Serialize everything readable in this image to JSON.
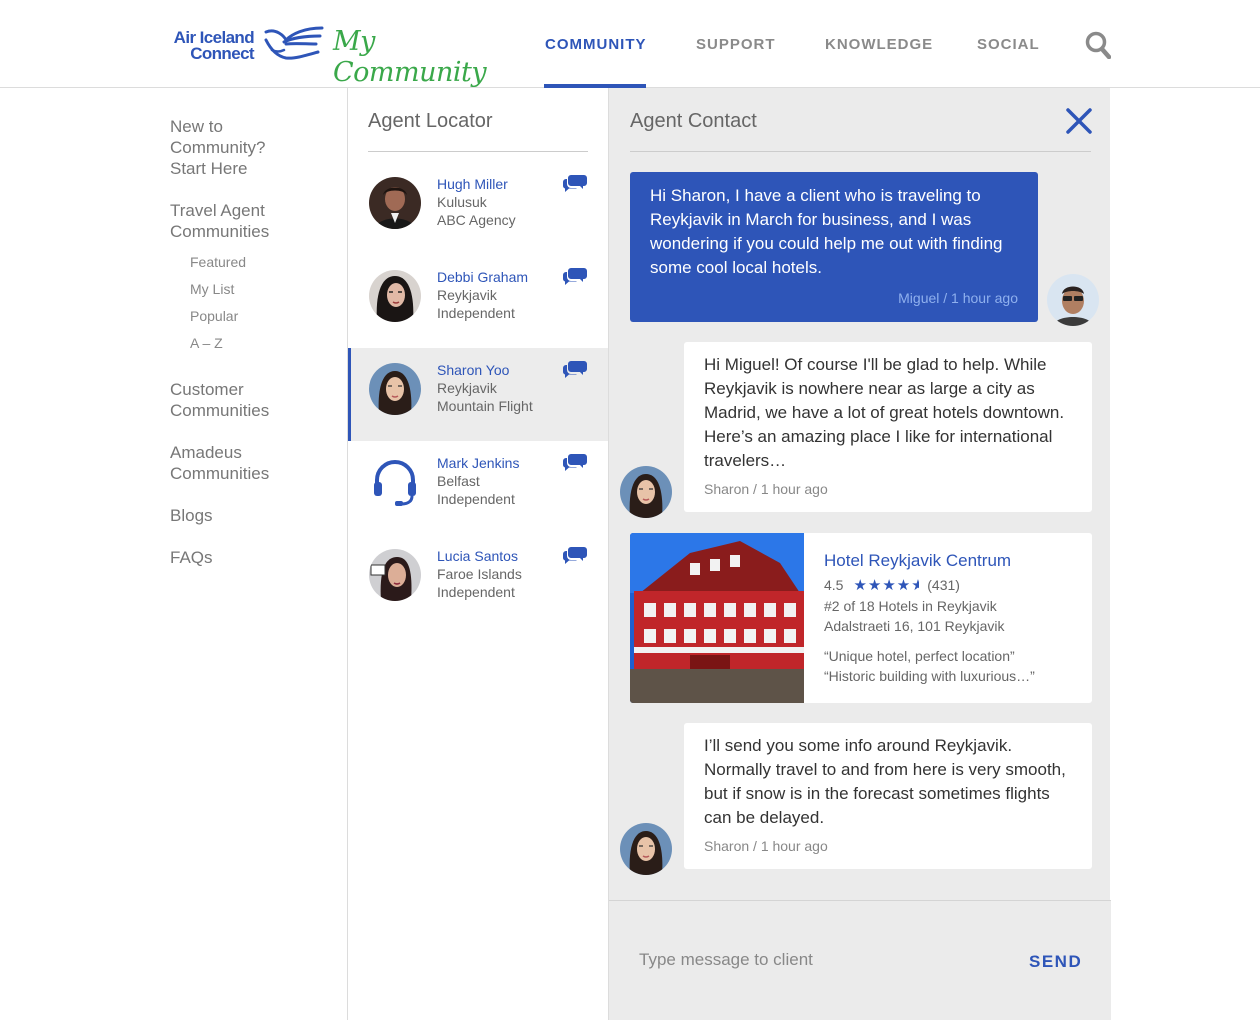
{
  "brand": {
    "name_line1": "Air Iceland",
    "name_line2": "Connect",
    "script_title": "My Community"
  },
  "nav": {
    "items": [
      {
        "label": "COMMUNITY",
        "active": true
      },
      {
        "label": "SUPPORT",
        "active": false
      },
      {
        "label": "KNOWLEDGE",
        "active": false
      },
      {
        "label": "SOCIAL",
        "active": false
      }
    ],
    "search_icon": "search-icon"
  },
  "sidebar": {
    "items": [
      {
        "label": "New to\nCommunity?\nStart Here"
      },
      {
        "label": "Travel Agent\nCommunities"
      },
      {
        "label": "Customer\nCommunities"
      },
      {
        "label": "Amadeus\nCommunities"
      },
      {
        "label": "Blogs"
      },
      {
        "label": "FAQs"
      }
    ],
    "subitems": [
      "Featured",
      "My List",
      "Popular",
      "A – Z"
    ]
  },
  "locator": {
    "title": "Agent Locator",
    "agents": [
      {
        "name": "Hugh Miller",
        "location": "Kulusuk",
        "agency": "ABC Agency",
        "selected": false
      },
      {
        "name": "Debbi Graham",
        "location": "Reykjavik",
        "agency": "Independent",
        "selected": false
      },
      {
        "name": "Sharon Yoo",
        "location": "Reykjavik",
        "agency": "Mountain Flight",
        "selected": true
      },
      {
        "name": "Mark Jenkins",
        "location": "Belfast",
        "agency": "Independent",
        "selected": false
      },
      {
        "name": "Lucia Santos",
        "location": "Faroe Islands",
        "agency": "Independent",
        "selected": false
      }
    ]
  },
  "contact": {
    "title": "Agent Contact",
    "messages": [
      {
        "text": "Hi Sharon, I have a client who is traveling to Reykjavik in March for business, and I was wondering if you could help me out with finding some cool local hotels.",
        "meta": "Miguel / 1 hour ago"
      },
      {
        "text": "Hi Miguel! Of course I'll be glad to help. While Reykjavik is nowhere near as large a city as Madrid, we have a lot of great hotels downtown. Here’s an amazing place I like for international travelers…",
        "meta": "Sharon / 1 hour ago"
      },
      {
        "text": "I’ll send you some info around Reykjavik. Normally travel to and from here is very smooth, but if snow is in the forecast sometimes flights can be delayed.",
        "meta": "Sharon / 1 hour ago"
      }
    ],
    "hotel": {
      "name": "Hotel Reykjavik Centrum",
      "rating": "4.5",
      "rating_value": 4.5,
      "reviews": "(431)",
      "rank": "#2 of 18 Hotels in Reykjavik",
      "address": "Adalstraeti 16, 101 Reykjavik",
      "quote1": "“Unique hotel, perfect location”",
      "quote2": "“Historic building with luxurious…”"
    },
    "compose": {
      "placeholder": "Type message to client",
      "value": "",
      "send_label": "SEND"
    }
  },
  "colors": {
    "accent": "#2e55b8",
    "brand_green": "#3aa84a",
    "panel_bg": "#ebebeb"
  }
}
